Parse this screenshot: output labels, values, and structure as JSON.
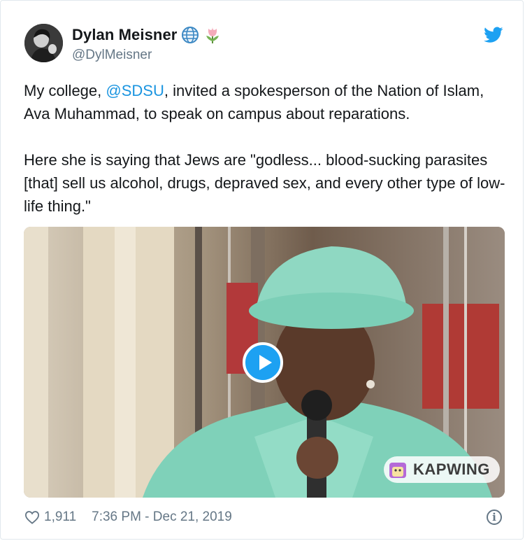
{
  "author": {
    "name": "Dylan Meisner",
    "handle": "@DylMeisner",
    "avatar_icon": "user-avatar",
    "badges": [
      "globe-icon",
      "tulip-icon"
    ]
  },
  "tweet": {
    "para1_pre": "My college, ",
    "para1_mention": "@SDSU",
    "para1_post": ", invited a spokesperson of the Nation of Islam, Ava Muhammad, to speak on campus about reparations.",
    "para2": "Here she is saying that Jews are \"godless... blood-sucking parasites [that] sell us alcohol, drugs, depraved sex, and every other type of low-life thing.\""
  },
  "media": {
    "type": "video",
    "watermark": "KAPWING"
  },
  "footer": {
    "likes": "1,911",
    "timestamp": "7:36 PM - Dec 21, 2019"
  },
  "colors": {
    "accent": "#1da1f2",
    "mention": "#1b95e0",
    "muted": "#657786"
  }
}
